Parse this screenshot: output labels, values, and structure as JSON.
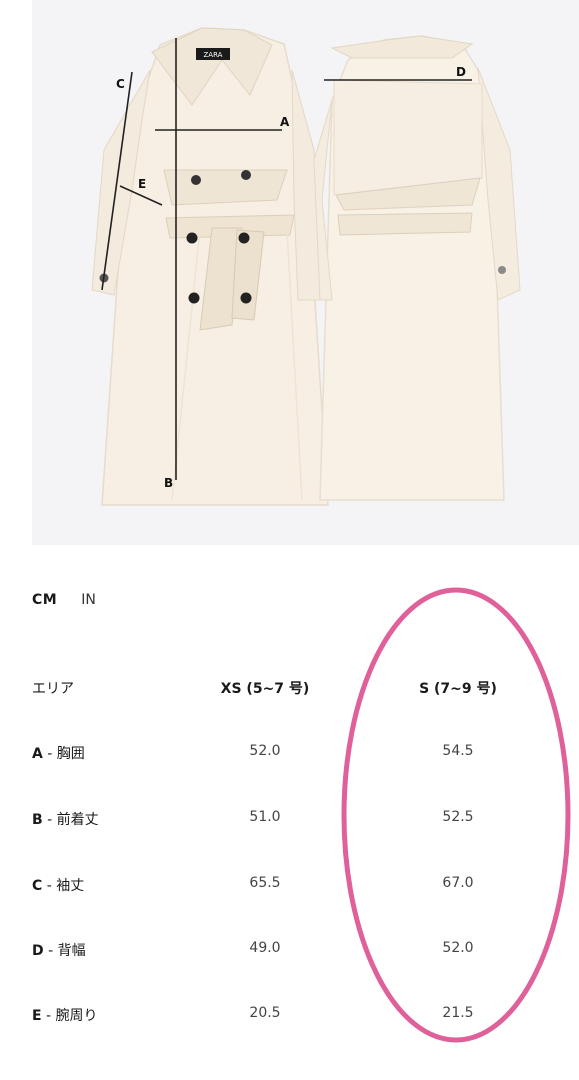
{
  "figure": {
    "brand_label": "ZARA",
    "markers": {
      "a": "A",
      "b": "B",
      "c": "C",
      "d": "D",
      "e": "E"
    }
  },
  "units": {
    "active": "CM",
    "inactive": "IN"
  },
  "table": {
    "header": {
      "area": "エリア",
      "xs": "XS (5~7 号)",
      "s": "S (7~9 号)"
    },
    "rows": [
      {
        "code": "A",
        "label": " - 胸囲",
        "xs": "52.0",
        "s": "54.5"
      },
      {
        "code": "B",
        "label": " - 前着丈",
        "xs": "51.0",
        "s": "52.5"
      },
      {
        "code": "C",
        "label": " - 袖丈",
        "xs": "65.5",
        "s": "67.0"
      },
      {
        "code": "D",
        "label": " - 背幅",
        "xs": "49.0",
        "s": "52.0"
      },
      {
        "code": "E",
        "label": " - 腕周り",
        "xs": "20.5",
        "s": "21.5"
      }
    ]
  },
  "colors": {
    "highlight": "#e0609a",
    "coat": "#f6efe4",
    "button": "#222222"
  }
}
